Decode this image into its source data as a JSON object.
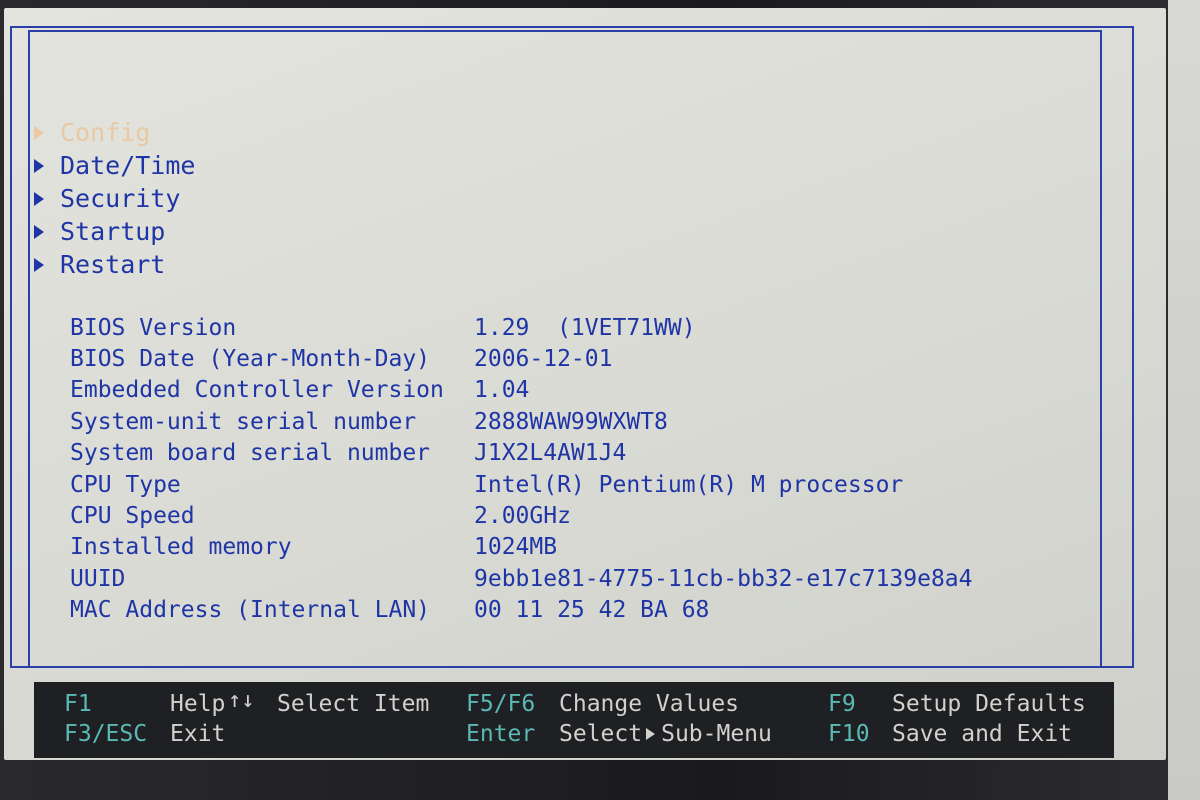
{
  "menu": {
    "items": [
      {
        "label": "Config",
        "active": true
      },
      {
        "label": "Date/Time",
        "active": false
      },
      {
        "label": "Security",
        "active": false
      },
      {
        "label": "Startup",
        "active": false
      },
      {
        "label": "Restart",
        "active": false
      }
    ]
  },
  "info": {
    "rows": [
      {
        "label": "BIOS Version",
        "value": "1.29  (1VET71WW)"
      },
      {
        "label": "BIOS Date (Year-Month-Day)",
        "value": "2006-12-01"
      },
      {
        "label": "Embedded Controller Version",
        "value": "1.04"
      },
      {
        "label": "System-unit serial number",
        "value": "2888WAW99WXWT8"
      },
      {
        "label": "System board serial number",
        "value": "J1X2L4AW1J4"
      },
      {
        "label": "CPU Type",
        "value": "Intel(R) Pentium(R) M processor"
      },
      {
        "label": "CPU Speed",
        "value": "2.00GHz"
      },
      {
        "label": "Installed memory",
        "value": "1024MB"
      },
      {
        "label": "UUID",
        "value": "9ebb1e81-4775-11cb-bb32-e17c7139e8a4"
      },
      {
        "label": "MAC Address (Internal LAN)",
        "value": "00 11 25 42 BA 68"
      }
    ]
  },
  "footer": {
    "f1_key": "F1",
    "f1_desc": "Help",
    "arrows": "↑↓",
    "select_item": "Select Item",
    "f5f6_key": "F5/F6",
    "f5f6_desc": "Change Values",
    "f9_key": "F9",
    "f9_desc": "Setup Defaults",
    "f3_key": "F3/ESC",
    "f3_desc": "Exit",
    "enter_key": "Enter",
    "enter_desc_a": "Select",
    "enter_desc_b": "Sub-Menu",
    "f10_key": "F10",
    "f10_desc": "Save and Exit"
  },
  "colors": {
    "text": "#1f35a6",
    "highlight": "#e8c9a4",
    "key": "#5ab9b4",
    "footer_bg": "#1f2023",
    "screen_bg": "#dcdcd6"
  }
}
